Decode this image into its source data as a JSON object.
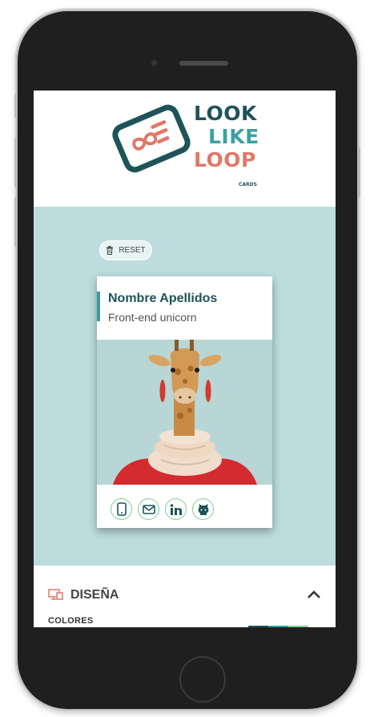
{
  "logo": {
    "line1": "LOOK",
    "line2": "LIKE",
    "line3": "LOOP",
    "tagline": "CARDS",
    "colors": {
      "dark": "#1e5458",
      "teal": "#3aa1a2",
      "coral": "#e17768"
    }
  },
  "preview": {
    "reset_label": "RESET",
    "reset_icon": "trash-icon",
    "background": "#bcdcdd"
  },
  "card": {
    "name": "Nombre Apellidos",
    "job": "Front-end unicorn",
    "photo": "giraffe-with-scarf",
    "social": [
      {
        "icon": "mobile-phone-icon"
      },
      {
        "icon": "envelope-icon"
      },
      {
        "icon": "linkedin-icon"
      },
      {
        "icon": "github-icon"
      }
    ]
  },
  "design": {
    "title": "DISEÑA",
    "icon": "design-icon",
    "toggle_icon": "chevron-up-icon",
    "colors_label": "COLORES",
    "palette": [
      "#1e5458",
      "#3a9b9d",
      "#7bcf8d"
    ]
  }
}
